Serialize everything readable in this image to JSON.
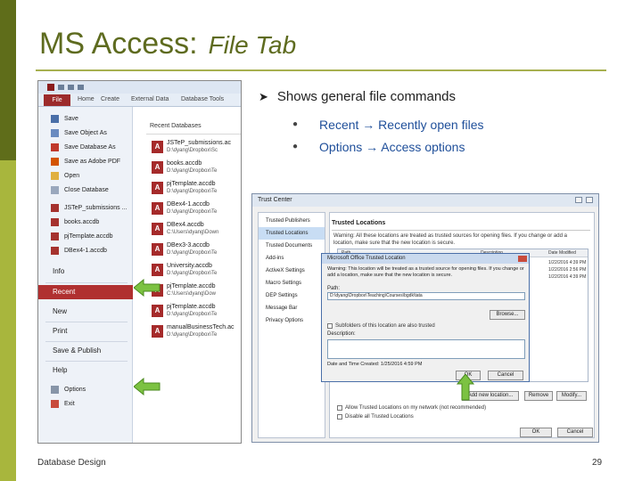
{
  "slide": {
    "title": "MS Access:",
    "subtitle": "File Tab",
    "bullet_main": "Shows general file commands",
    "bullets": [
      "Recent → Recently open files",
      "Options → Access options"
    ],
    "footer_left": "Database Design",
    "page_number": "29"
  },
  "backstage": {
    "file_tab": "File",
    "ribbon_tabs": [
      "Home",
      "Create",
      "External Data",
      "Database Tools"
    ],
    "menu_items": [
      {
        "label": "Save",
        "icon": "save-icon"
      },
      {
        "label": "Save Object As",
        "icon": "save-object-icon"
      },
      {
        "label": "Save Database As",
        "icon": "save-database-icon"
      },
      {
        "label": "Save as Adobe PDF",
        "icon": "pdf-icon"
      },
      {
        "label": "Open",
        "icon": "open-folder-icon"
      },
      {
        "label": "Close Database",
        "icon": "close-database-icon"
      }
    ],
    "recent_files": [
      "JSTeP_submissions ...",
      "books.accdb",
      "pjTemplate.accdb",
      "DBex4-1.accdb"
    ],
    "heads": [
      "Info",
      "Recent",
      "New",
      "Print",
      "Save & Publish",
      "Help"
    ],
    "bottom_items": [
      {
        "label": "Options",
        "icon": "options-icon"
      },
      {
        "label": "Exit",
        "icon": "exit-icon"
      }
    ],
    "recent_heading": "Recent Databases",
    "recent_list": [
      {
        "name": "JSTeP_submissions.ac",
        "path": "D:\\dyang\\Dropbox\\Sc"
      },
      {
        "name": "books.accdb",
        "path": "D:\\dyang\\Dropbox\\Te"
      },
      {
        "name": "pjTemplate.accdb",
        "path": "D:\\dyang\\Dropbox\\Te"
      },
      {
        "name": "DBex4-1.accdb",
        "path": "D:\\dyang\\Dropbox\\Te"
      },
      {
        "name": "DBex4.accdb",
        "path": "C:\\Users\\dyang\\Down"
      },
      {
        "name": "DBex3-3.accdb",
        "path": "D:\\dyang\\Dropbox\\Te"
      },
      {
        "name": "University.accdb",
        "path": "D:\\dyang\\Dropbox\\Te"
      },
      {
        "name": "pjTemplate.accdb",
        "path": "C:\\Users\\dyang\\Dow"
      },
      {
        "name": "pjTemplate.accdb",
        "path": "D:\\dyang\\Dropbox\\Te"
      },
      {
        "name": "manualBusinessTech.ac",
        "path": "D:\\dyang\\Dropbox\\Te"
      }
    ]
  },
  "trust_center": {
    "title": "Trust Center",
    "nav": [
      "Trusted Publishers",
      "Trusted Locations",
      "Trusted Documents",
      "Add-ins",
      "ActiveX Settings",
      "Macro Settings",
      "DEP Settings",
      "Message Bar",
      "Privacy Options"
    ],
    "panel_heading": "Trusted Locations",
    "warning": "Warning: All these locations are treated as trusted sources for opening files. If you change or add a location, make sure that the new location is secure.",
    "list_headers": [
      "Path",
      "Description",
      "Date Modified"
    ],
    "dates": [
      "1/22/2016 4:39 PM",
      "1/22/2016 2:56 PM",
      "1/22/2016 4:39 PM"
    ],
    "buttons": [
      "Add new location...",
      "Remove",
      "Modify..."
    ],
    "allow_network": "Allow Trusted Locations on my network (not recommended)",
    "disable_all": "Disable all Trusted Locations",
    "ok": "OK",
    "cancel": "Cancel"
  },
  "trusted_location": {
    "title": "Microsoft Office Trusted Location",
    "warning": "Warning: This location will be treated as a trusted source for opening files. If you change or add a location, make sure that the new location is secure.",
    "path_label": "Path:",
    "path_value": "D:\\dyang\\Dropbox\\Teaching\\Courses\\bgdk\\tata",
    "browse": "Browse...",
    "subfolders": "Subfolders of this location are also trusted",
    "description_label": "Description:",
    "date_created": "Date and Time Created: 1/25/2016 4:59 PM",
    "ok": "OK",
    "cancel": "Cancel"
  },
  "colors": {
    "title_green": "#5e6b1f",
    "bar_dark": "#5f6d1a",
    "bar_light": "#a8b63d",
    "link_blue": "#1f4f9a",
    "access_red": "#b03030",
    "arrow_green": "#7cc242"
  }
}
